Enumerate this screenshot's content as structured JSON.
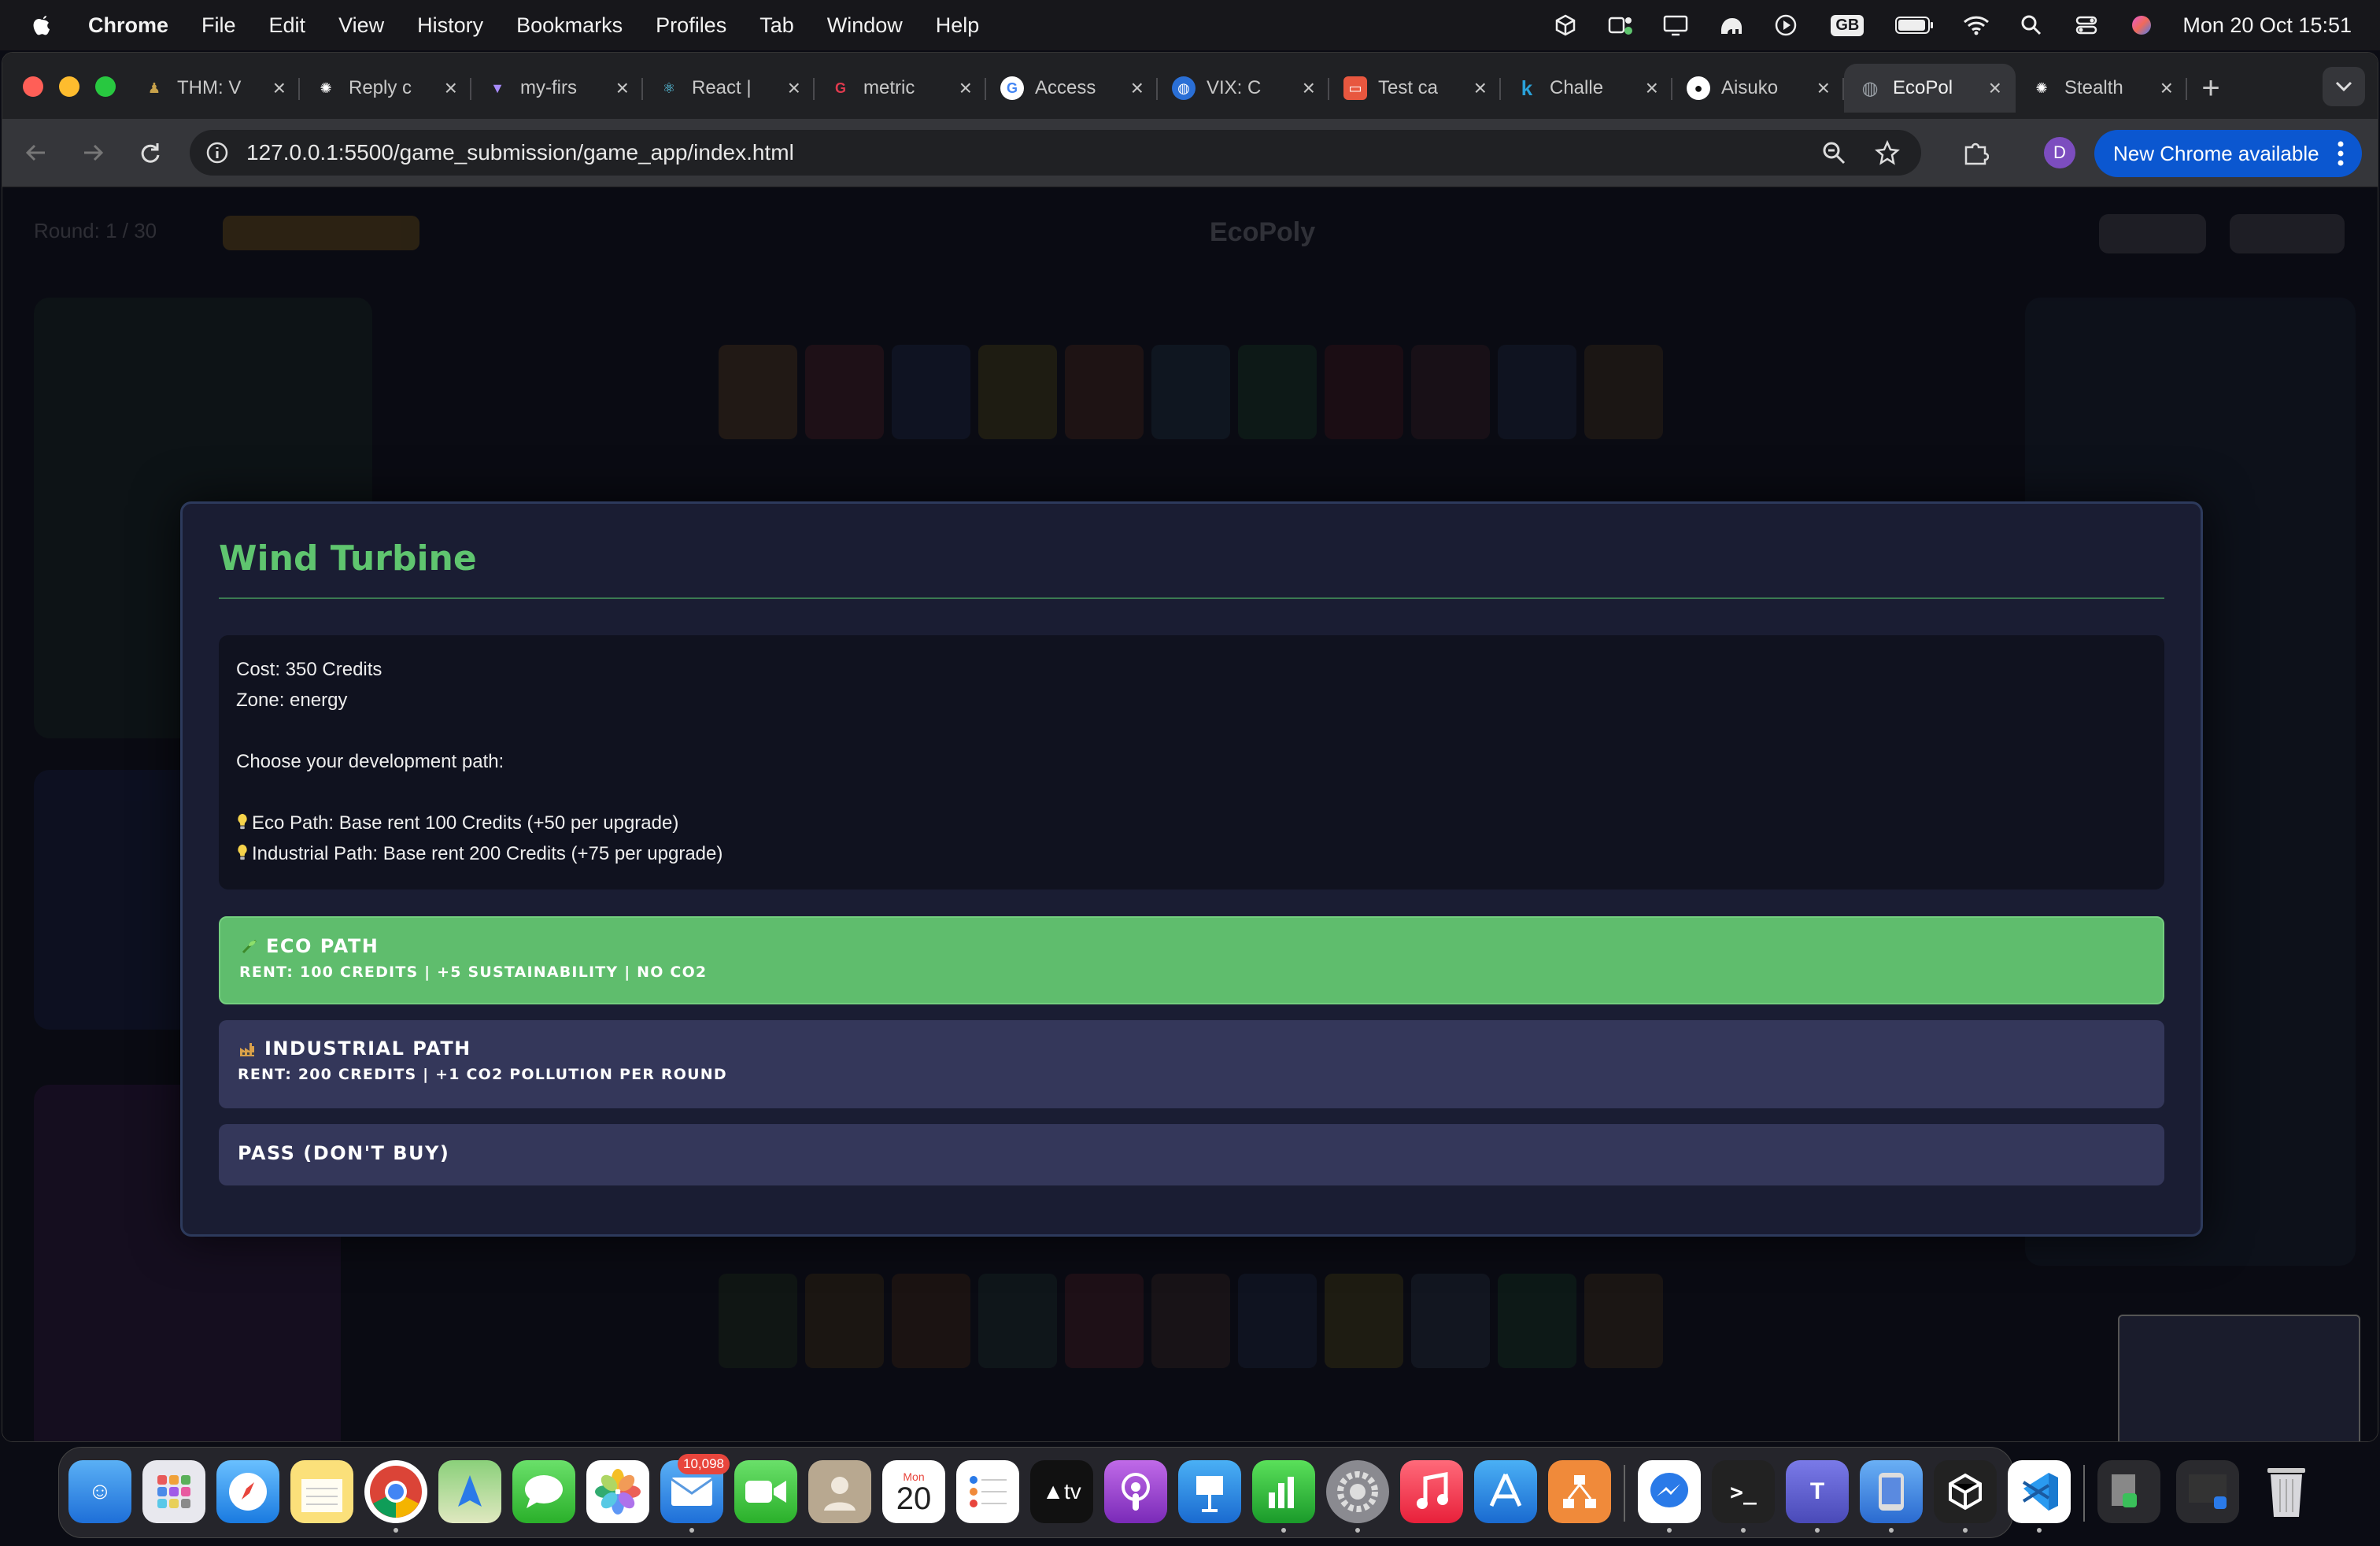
{
  "menubar": {
    "app_name": "Chrome",
    "items": [
      "File",
      "Edit",
      "View",
      "History",
      "Bookmarks",
      "Profiles",
      "Tab",
      "Window",
      "Help"
    ],
    "clock": "Mon 20 Oct  15:51",
    "input_source": "GB",
    "status_icons": [
      "cube-icon",
      "teams-icon",
      "display-icon",
      "elephant-icon",
      "play-icon",
      "keyboard-gb-icon",
      "battery-icon",
      "wifi-icon",
      "spotlight-search-icon",
      "control-center-icon",
      "siri-icon"
    ]
  },
  "browser": {
    "tabs": [
      {
        "title": "THM: V",
        "icon": "tryhackme-icon",
        "color": "#c8a24a"
      },
      {
        "title": "Reply c",
        "icon": "openai-icon",
        "color": "#555555"
      },
      {
        "title": "my-firs",
        "icon": "vite-icon",
        "color": "#8b5cf6"
      },
      {
        "title": "React |",
        "icon": "react-icon",
        "color": "#3b82c4"
      },
      {
        "title": "metric",
        "icon": "metric-icon",
        "color": "#e03a4e"
      },
      {
        "title": "Access",
        "icon": "google-icon",
        "color": "#ffffff"
      },
      {
        "title": "VIX: C",
        "icon": "globe-icon",
        "color": "#2a6fd6"
      },
      {
        "title": "Test ca",
        "icon": "slides-icon",
        "color": "#e8573f"
      },
      {
        "title": "Challe",
        "icon": "kaggle-icon",
        "color": "#2aa1d8"
      },
      {
        "title": "Aisuko",
        "icon": "github-icon",
        "color": "#ffffff"
      },
      {
        "title": "EcoPol",
        "icon": "globe-icon",
        "color": "#9aa0a6",
        "active": true
      },
      {
        "title": "Stealth",
        "icon": "openai-icon",
        "color": "#cccccc"
      }
    ],
    "url": "127.0.0.1:5500/game_submission/game_app/index.html",
    "profile_initial": "D",
    "update_button": "New Chrome available"
  },
  "game_background": {
    "round_label": "Round: 1 / 30",
    "title": "EcoPoly"
  },
  "modal": {
    "title": "Wind Turbine",
    "cost_line": "Cost: 350 Credits",
    "zone_line": "Zone: energy",
    "prompt": "Choose your development path:",
    "eco_info": "Eco Path: Base rent 100 Credits (+50 per upgrade)",
    "industrial_info": "Industrial Path: Base rent 200 Credits (+75 per upgrade)",
    "options": {
      "eco": {
        "title": "ECO PATH",
        "subtitle": "RENT: 100 CREDITS | +5 SUSTAINABILITY | NO CO2"
      },
      "industrial": {
        "title": "INDUSTRIAL PATH",
        "subtitle": "RENT: 200 CREDITS | +1 CO2 POLLUTION PER ROUND"
      },
      "pass": {
        "title": "PASS (DON'T BUY)"
      }
    },
    "colors": {
      "accent_green": "#5fc56f",
      "eco_button": "#5fbd6d",
      "neutral_button": "#34375a"
    }
  },
  "dock": {
    "mail_badge": "10,098",
    "calendar_month": "Mon",
    "calendar_day": "20",
    "tv_label": "tv",
    "apps": [
      "finder-icon",
      "launchpad-icon",
      "safari-icon",
      "notes-icon",
      "chrome-icon",
      "maps-icon",
      "messages-icon",
      "photos-icon",
      "mail-icon",
      "facetime-icon",
      "contacts-icon",
      "calendar-icon",
      "reminders-icon",
      "appletv-icon",
      "podcasts-icon",
      "keynote-icon",
      "numbers-icon",
      "system-settings-icon",
      "music-icon",
      "app-store-icon",
      "drawio-icon",
      "messenger-icon",
      "terminal-icon",
      "teams-icon",
      "simulator-icon",
      "unity-icon",
      "vscode-icon",
      "downloads-stack-icon",
      "window-stack-icon",
      "trash-icon"
    ]
  }
}
